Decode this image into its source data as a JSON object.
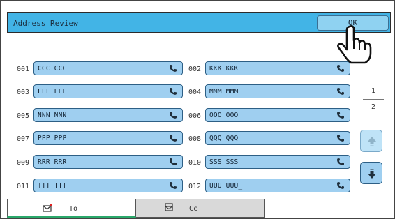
{
  "header": {
    "title": "Address Review",
    "ok_label": "OK"
  },
  "entries": [
    {
      "num": "001",
      "label": "CCC CCC"
    },
    {
      "num": "002",
      "label": "KKK KKK"
    },
    {
      "num": "003",
      "label": "LLL LLL"
    },
    {
      "num": "004",
      "label": "MMM MMM"
    },
    {
      "num": "005",
      "label": "NNN NNN"
    },
    {
      "num": "006",
      "label": "OOO OOO"
    },
    {
      "num": "007",
      "label": "PPP PPP"
    },
    {
      "num": "008",
      "label": "QQQ QQQ"
    },
    {
      "num": "009",
      "label": "RRR RRR"
    },
    {
      "num": "010",
      "label": "SSS SSS"
    },
    {
      "num": "011",
      "label": "TTT TTT"
    },
    {
      "num": "012",
      "label": "UUU UUU_"
    }
  ],
  "pager": {
    "current": "1",
    "total": "2"
  },
  "tabs": {
    "to": "To",
    "cc": "Cc"
  },
  "icons": {
    "entry": "phone-icon",
    "scroll_up": "arrow-up-icon",
    "scroll_down": "arrow-down-icon",
    "tab_to": "envelope-icon",
    "tab_cc": "envelope-stack-icon",
    "pointer": "hand-pointer-icon"
  },
  "colors": {
    "header": "#42b4e6",
    "button": "#9fcff0",
    "active_tab_underline": "#2aa86a"
  }
}
